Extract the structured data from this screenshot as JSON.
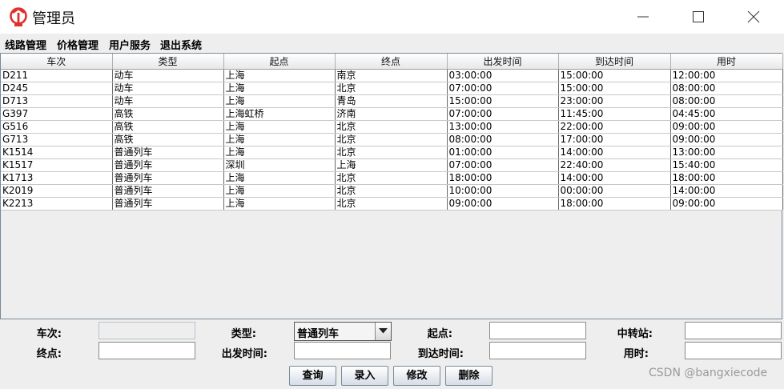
{
  "window": {
    "title": "管理员"
  },
  "menu": [
    "线路管理",
    "价格管理",
    "用户服务",
    "退出系统"
  ],
  "table": {
    "columns": [
      "车次",
      "类型",
      "起点",
      "终点",
      "出发时间",
      "到达时间",
      "用时"
    ],
    "rows": [
      [
        "D211",
        "动车",
        "上海",
        "南京",
        "03:00:00",
        "15:00:00",
        "12:00:00"
      ],
      [
        "D245",
        "动车",
        "上海",
        "北京",
        "07:00:00",
        "15:00:00",
        "08:00:00"
      ],
      [
        "D713",
        "动车",
        "上海",
        "青岛",
        "15:00:00",
        "23:00:00",
        "08:00:00"
      ],
      [
        "G397",
        "高铁",
        "上海虹桥",
        "济南",
        "07:00:00",
        "11:45:00",
        "04:45:00"
      ],
      [
        "G516",
        "高铁",
        "上海",
        "北京",
        "13:00:00",
        "22:00:00",
        "09:00:00"
      ],
      [
        "G713",
        "高铁",
        "上海",
        "北京",
        "08:00:00",
        "17:00:00",
        "09:00:00"
      ],
      [
        "K1514",
        "普通列车",
        "上海",
        "北京",
        "01:00:00",
        "14:00:00",
        "13:00:00"
      ],
      [
        "K1517",
        "普通列车",
        "深圳",
        "上海",
        "07:00:00",
        "22:40:00",
        "15:40:00"
      ],
      [
        "K1713",
        "普通列车",
        "上海",
        "北京",
        "18:00:00",
        "14:00:00",
        "18:00:00"
      ],
      [
        "K2019",
        "普通列车",
        "上海",
        "北京",
        "10:00:00",
        "00:00:00",
        "14:00:00"
      ],
      [
        "K2213",
        "普通列车",
        "上海",
        "北京",
        "09:00:00",
        "18:00:00",
        "09:00:00"
      ]
    ]
  },
  "form": {
    "train_no_label": "车次:",
    "type_label": "类型:",
    "type_value": "普通列车",
    "origin_label": "起点:",
    "transfer_label": "中转站:",
    "dest_label": "终点:",
    "depart_label": "出发时间:",
    "arrive_label": "到达时间:",
    "duration_label": "用时:",
    "train_no_value": "",
    "origin_value": "",
    "transfer_value": "",
    "dest_value": "",
    "depart_value": "",
    "arrive_value": "",
    "duration_value": ""
  },
  "buttons": {
    "query": "查询",
    "add": "录入",
    "edit": "修改",
    "delete": "删除"
  },
  "watermark": "CSDN @bangxiecode",
  "colors": {
    "icon_red": "#e0302a",
    "border_blue": "#7a8a99"
  }
}
